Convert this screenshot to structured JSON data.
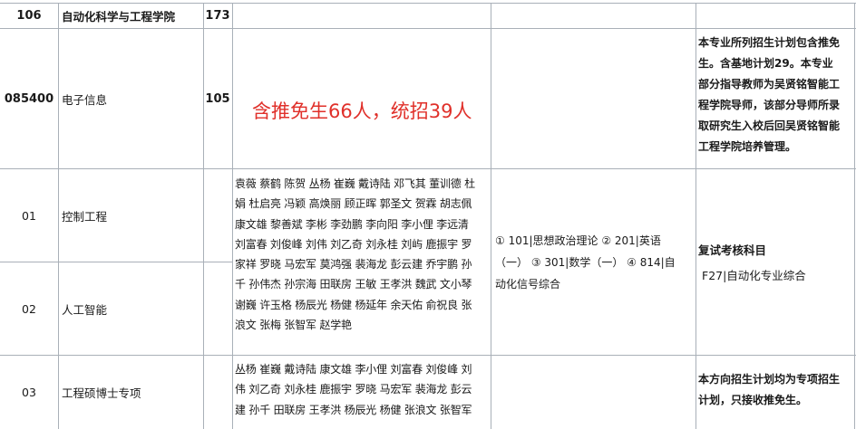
{
  "rows": {
    "dept": {
      "code": "106",
      "name": "自动化科学与工程学院",
      "count": "173"
    },
    "major": {
      "code": "085400",
      "name": "电子信息",
      "count": "105",
      "annotation": "含推免生66人，统招39人",
      "note_lines": [
        "本专业所列招生计划包含推免",
        "生。含基地计划29。本专业",
        "部分指导教师为吴贤铭智能工",
        "程学院导师，该部分导师所录",
        "取研究生入校后回吴贤铭智能",
        "工程学院培养管理。"
      ]
    },
    "dir01": {
      "code": "01",
      "name": "控制工程"
    },
    "dir02": {
      "code": "02",
      "name": "人工智能"
    },
    "dir03": {
      "code": "03",
      "name": "工程硕博士专项"
    },
    "advisors_a_lines": [
      "袁薇 蔡鹤 陈贺 丛杨 崔巍 戴诗陆 邓飞其 董训德 杜",
      "娟 杜启亮 冯颖 高焕丽 顾正晖 郭圣文 贺霖 胡志佩",
      "康文雄 黎善斌 李彬 李劲鹏 李向阳 李小俚 李远清",
      "刘富春 刘俊峰 刘伟 刘乙奇 刘永桂 刘屿 鹿振宇 罗",
      "家祥 罗晓 马宏军 莫鸿强 裴海龙 彭云建 乔宇鹏 孙",
      "千 孙伟杰 孙宗海 田联房 王敏 王孝洪 魏武 文小琴",
      "谢巍 许玉格 杨辰光 杨健 杨延年 余天佑 俞祝良 张",
      "浪文 张梅 张智军 赵学艳"
    ],
    "advisors_b_lines": [
      "丛杨 崔巍 戴诗陆 康文雄 李小俚 刘富春 刘俊峰 刘",
      "伟 刘乙奇 刘永桂 鹿振宇 罗晓 马宏军 裴海龙 彭云",
      "建 孙千 田联房 王孝洪 杨辰光 杨健 张浪文 张智军"
    ],
    "exam_lines": [
      "① 101|思想政治理论  ② 201|英语",
      "（一）  ③ 301|数学（一）  ④ 814|自",
      "动化信号综合"
    ],
    "retest": {
      "title": "复试考核科目",
      "subject": "F27|自动化专业综合"
    },
    "note03_lines": [
      "本方向招生计划均为专项招生",
      "计划，只接收推免生。"
    ]
  },
  "colors": {
    "grid": "#a9b0b8",
    "annotation": "#e0302a",
    "text": "#1a1a1a"
  }
}
